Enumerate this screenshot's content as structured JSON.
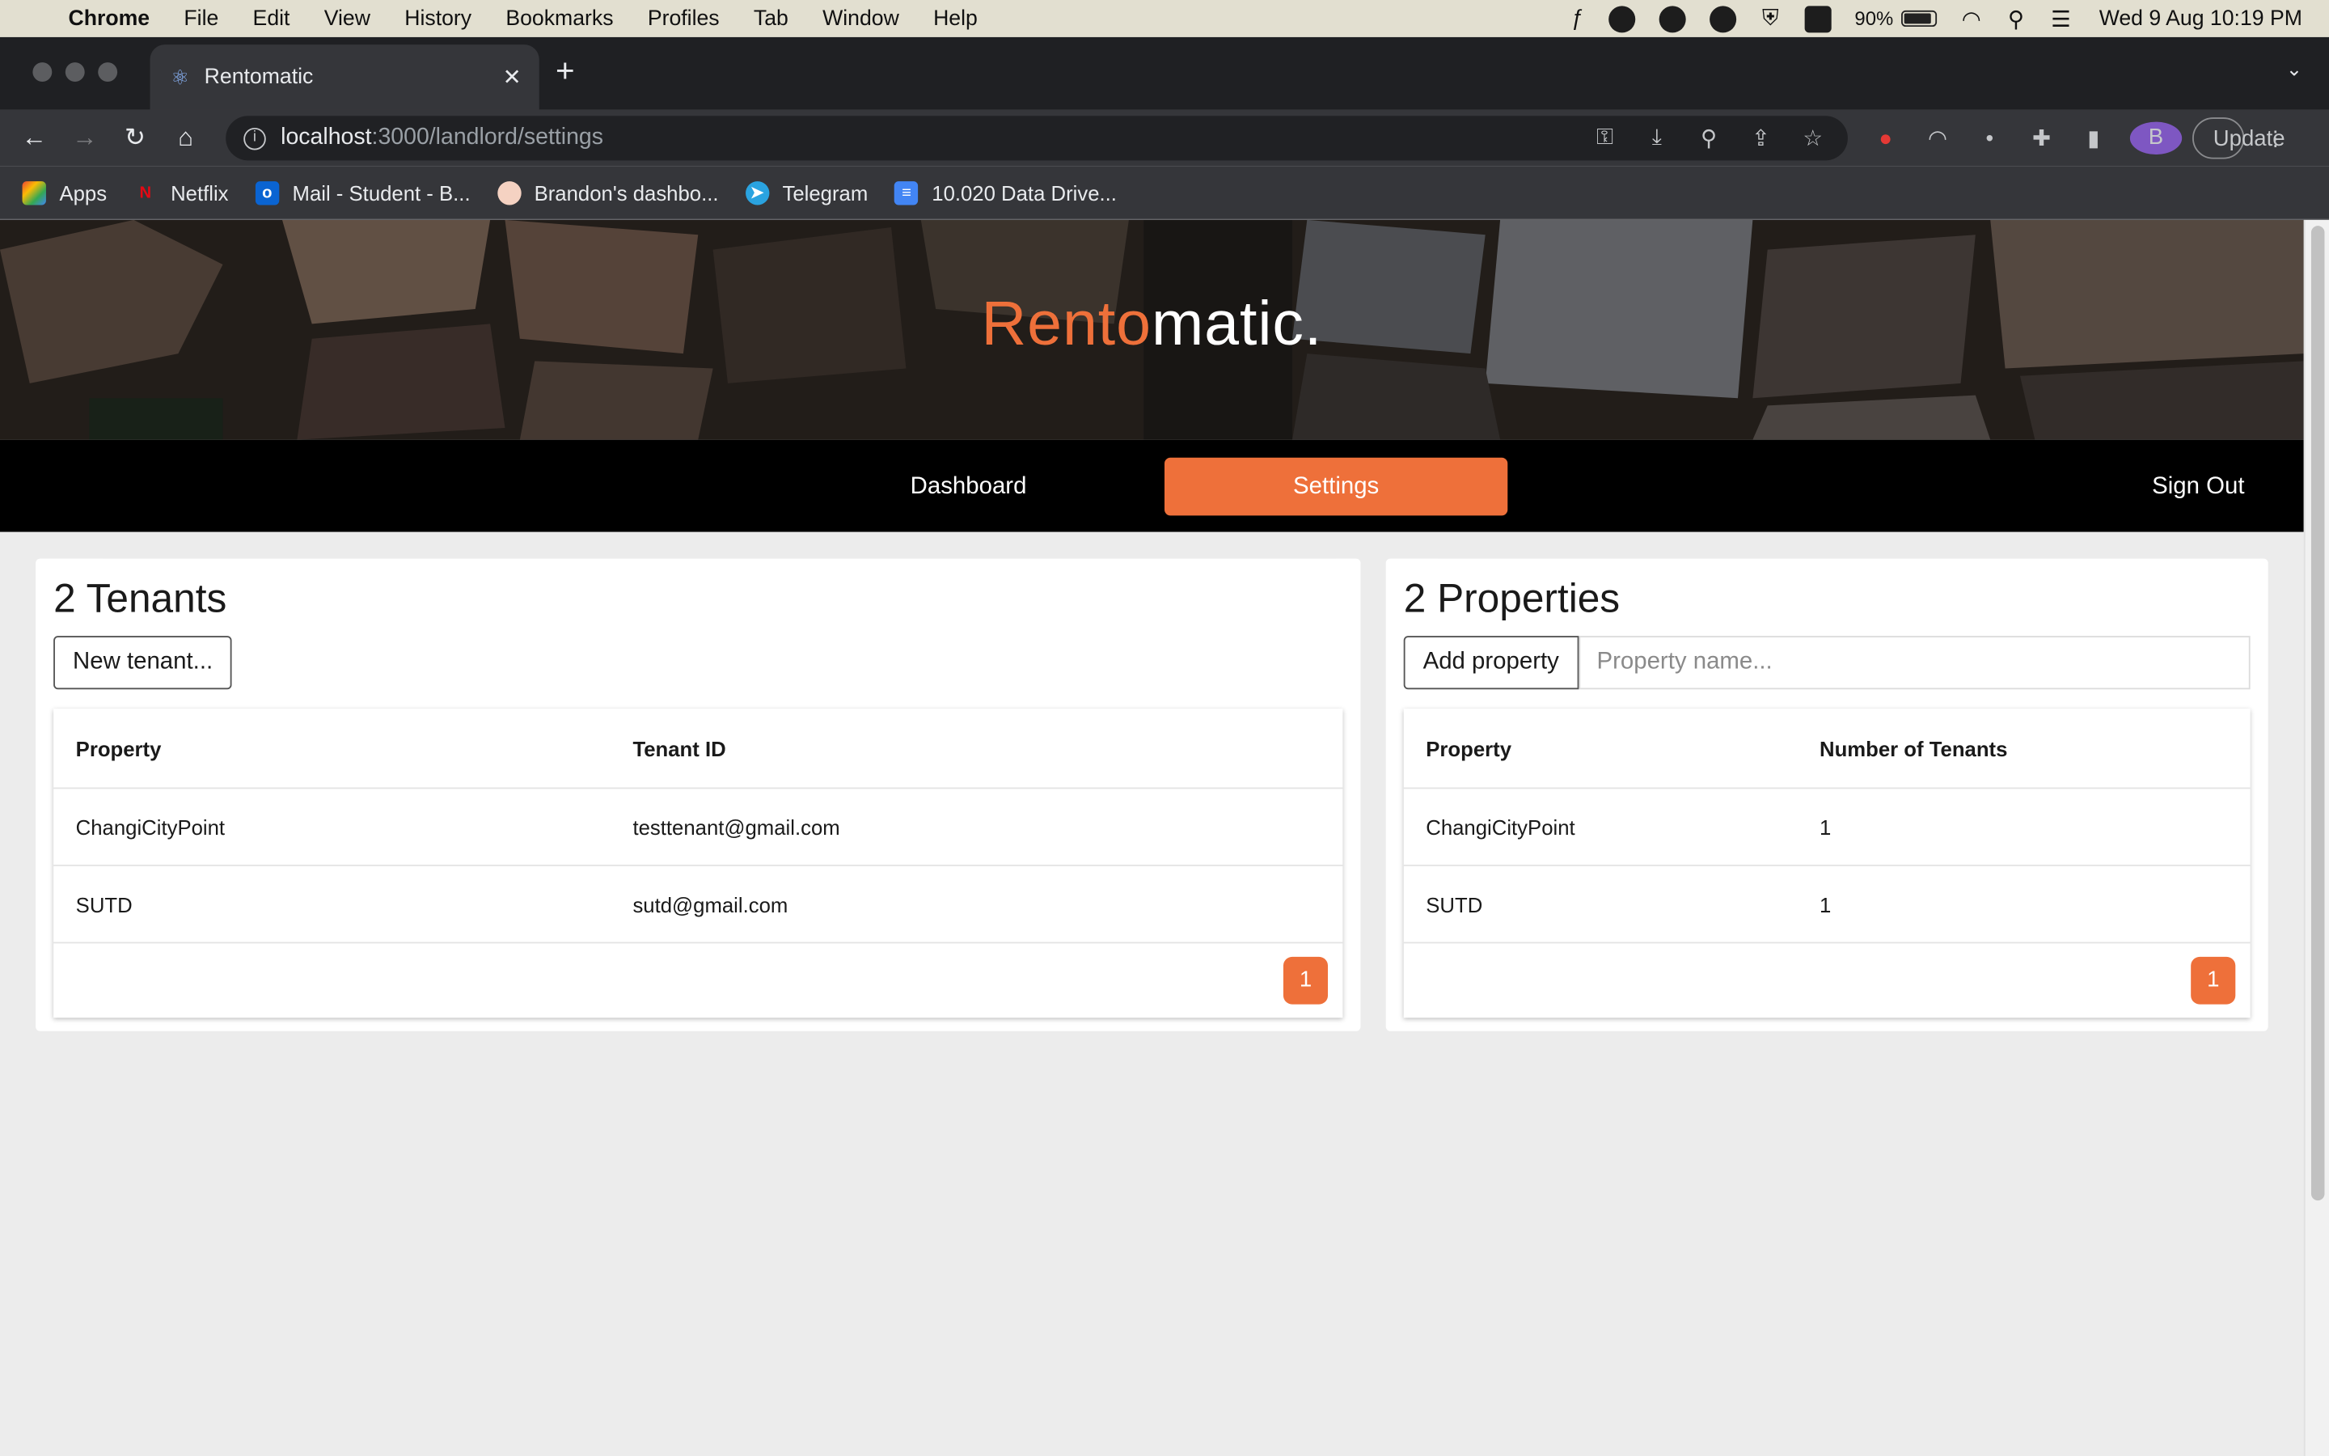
{
  "menubar": {
    "app": "Chrome",
    "items": [
      "File",
      "Edit",
      "View",
      "History",
      "Bookmarks",
      "Profiles",
      "Tab",
      "Window",
      "Help"
    ],
    "battery": "90%",
    "clock": "Wed 9 Aug  10:19 PM"
  },
  "browser": {
    "tab_title": "Rentomatic",
    "url_host": "localhost",
    "url_path": ":3000/landlord/settings",
    "profile_initial": "B",
    "update_label": "Update"
  },
  "bookmarks": [
    {
      "label": "Apps",
      "icon": "apps-grid-icon"
    },
    {
      "label": "Netflix",
      "icon": "netflix-icon"
    },
    {
      "label": "Mail - Student - B...",
      "icon": "outlook-icon"
    },
    {
      "label": "Brandon's dashbo...",
      "icon": "dashboard-icon"
    },
    {
      "label": "Telegram",
      "icon": "telegram-icon"
    },
    {
      "label": "10.020 Data Drive...",
      "icon": "docs-icon"
    }
  ],
  "app": {
    "logo_accent": "Rento",
    "logo_rest": "matic.",
    "accent_color": "#ee703a",
    "nav": {
      "dashboard": "Dashboard",
      "settings": "Settings",
      "sign_out": "Sign Out"
    }
  },
  "tenants": {
    "title": "2 Tenants",
    "new_button": "New tenant...",
    "columns": [
      "Property",
      "Tenant ID"
    ],
    "rows": [
      {
        "property": "ChangiCityPoint",
        "tenant_id": "testtenant@gmail.com"
      },
      {
        "property": "SUTD",
        "tenant_id": "sutd@gmail.com"
      }
    ],
    "page": "1"
  },
  "properties": {
    "title": "2 Properties",
    "add_button": "Add property",
    "input_placeholder": "Property name...",
    "columns": [
      "Property",
      "Number of Tenants"
    ],
    "rows": [
      {
        "property": "ChangiCityPoint",
        "count": "1"
      },
      {
        "property": "SUTD",
        "count": "1"
      }
    ],
    "page": "1"
  }
}
